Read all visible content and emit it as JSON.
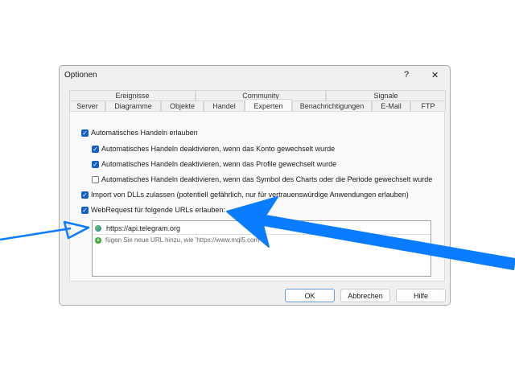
{
  "dialog": {
    "title": "Optionen",
    "help": "?",
    "close": "✕"
  },
  "tabs_row1": [
    "Ereignisse",
    "Community",
    "Signale"
  ],
  "tabs_row2": [
    "Server",
    "Diagramme",
    "Objekte",
    "Handel",
    "Experten",
    "Benachrichtigungen",
    "E-Mail",
    "FTP"
  ],
  "active_tab": "Experten",
  "options": [
    {
      "label": "Automatisches Handeln erlauben",
      "checked": true
    },
    {
      "label": "Automatisches Handeln deaktivieren, wenn das Konto gewechselt wurde",
      "checked": true
    },
    {
      "label": "Automatisches Handeln deaktivieren, wenn das Profile gewechselt wurde",
      "checked": true
    },
    {
      "label": "Automatisches Handeln deaktivieren, wenn das Symbol des Charts oder die Periode gewechselt wurde",
      "checked": false
    },
    {
      "label": "Import von DLLs zulassen (potentiell gefährlich, nur für vertrauenswürdige Anwendungen erlauben)",
      "checked": true
    },
    {
      "label": "WebRequest für folgende URLs erlauben:",
      "checked": true
    }
  ],
  "urls": {
    "items": [
      "https://api.telegram.org"
    ],
    "add_hint": "fügen Sie neue URL hinzu, wie 'https://www.mql5.com'"
  },
  "buttons": {
    "ok": "OK",
    "cancel": "Abbrechen",
    "help": "Hilfe"
  },
  "colors": {
    "accent": "#1360c0",
    "annotation": "#0a7cff"
  }
}
